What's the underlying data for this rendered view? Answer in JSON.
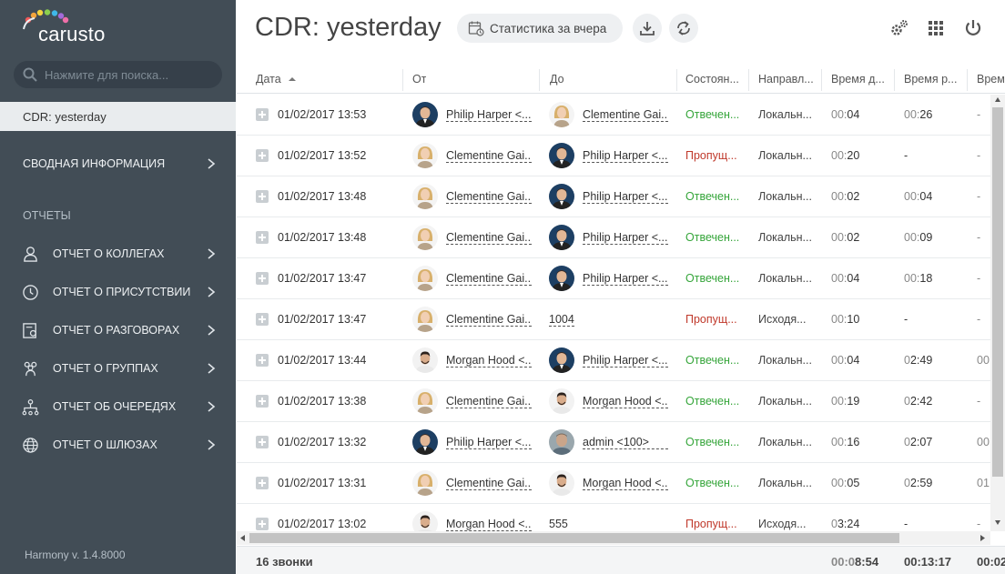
{
  "sidebar": {
    "logo_text": "carusto",
    "search_placeholder": "Нажмите для поиска...",
    "active_item": "CDR: yesterday",
    "summary_label": "СВОДНАЯ ИНФОРМАЦИЯ",
    "reports_title": "ОТЧЕТЫ",
    "items": [
      {
        "label": "ОТЧЕТ О КОЛЛЕГАХ",
        "icon": "user-icon"
      },
      {
        "label": "ОТЧЕТ О ПРИСУТСТВИИ",
        "icon": "clock-icon"
      },
      {
        "label": "ОТЧЕТ О РАЗГОВОРАХ",
        "icon": "conversation-report-icon"
      },
      {
        "label": "ОТЧЕТ О ГРУППАХ",
        "icon": "group-icon"
      },
      {
        "label": "ОТЧЕТ ОБ ОЧЕРЕДЯХ",
        "icon": "queue-icon"
      },
      {
        "label": "ОТЧЕТ О ШЛЮЗАХ",
        "icon": "globe-icon"
      }
    ],
    "version": "Harmony v. 1.4.8000"
  },
  "header": {
    "title": "CDR: yesterday",
    "stat_button": "Статистика за вчера"
  },
  "table": {
    "columns": [
      "Дата",
      "От",
      "До",
      "Состоян...",
      "Направл...",
      "Время д...",
      "Время р...",
      "Врем"
    ],
    "rows": [
      {
        "date": "01/02/2017 13:53",
        "from": "Philip Harper <...",
        "from_avatar": "philip",
        "to": "Clementine Gai...",
        "to_avatar": "clementine",
        "status": "Отвечен...",
        "status_type": "ok",
        "dir": "Локальн...",
        "t1a": "00:",
        "t1b": "04",
        "t2a": "00:",
        "t2b": "26",
        "t3": "-"
      },
      {
        "date": "01/02/2017 13:52",
        "from": "Clementine Gai...",
        "from_avatar": "clementine",
        "to": "Philip Harper <...",
        "to_avatar": "philip",
        "status": "Пропущ...",
        "status_type": "miss",
        "dir": "Локальн...",
        "t1a": "00:",
        "t1b": "20",
        "t2a": "",
        "t2b": "-",
        "t3": "-"
      },
      {
        "date": "01/02/2017 13:48",
        "from": "Clementine Gai...",
        "from_avatar": "clementine",
        "to": "Philip Harper <...",
        "to_avatar": "philip",
        "status": "Отвечен...",
        "status_type": "ok",
        "dir": "Локальн...",
        "t1a": "00:",
        "t1b": "02",
        "t2a": "00:",
        "t2b": "04",
        "t3": "-"
      },
      {
        "date": "01/02/2017 13:48",
        "from": "Clementine Gai...",
        "from_avatar": "clementine",
        "to": "Philip Harper <...",
        "to_avatar": "philip",
        "status": "Отвечен...",
        "status_type": "ok",
        "dir": "Локальн...",
        "t1a": "00:",
        "t1b": "02",
        "t2a": "00:",
        "t2b": "09",
        "t3": "-"
      },
      {
        "date": "01/02/2017 13:47",
        "from": "Clementine Gai...",
        "from_avatar": "clementine",
        "to": "Philip Harper <...",
        "to_avatar": "philip",
        "status": "Отвечен...",
        "status_type": "ok",
        "dir": "Локальн...",
        "t1a": "00:",
        "t1b": "04",
        "t2a": "00:",
        "t2b": "18",
        "t3": "-"
      },
      {
        "date": "01/02/2017 13:47",
        "from": "Clementine Gai...",
        "from_avatar": "clementine",
        "to": "1004",
        "to_avatar": "",
        "status": "Пропущ...",
        "status_type": "miss",
        "dir": "Исходя...",
        "t1a": "00:",
        "t1b": "10",
        "t2a": "",
        "t2b": "-",
        "t3": "-"
      },
      {
        "date": "01/02/2017 13:44",
        "from": "Morgan Hood <...",
        "from_avatar": "morgan",
        "to": "Philip Harper <...",
        "to_avatar": "philip",
        "status": "Отвечен...",
        "status_type": "ok",
        "dir": "Локальн...",
        "t1a": "00:",
        "t1b": "04",
        "t2a": "0",
        "t2b": "2:49",
        "t3": "00"
      },
      {
        "date": "01/02/2017 13:38",
        "from": "Clementine Gai...",
        "from_avatar": "clementine",
        "to": "Morgan Hood <...",
        "to_avatar": "morgan",
        "status": "Отвечен...",
        "status_type": "ok",
        "dir": "Локальн...",
        "t1a": "00:",
        "t1b": "19",
        "t2a": "0",
        "t2b": "2:42",
        "t3": "-"
      },
      {
        "date": "01/02/2017 13:32",
        "from": "Philip Harper <...",
        "from_avatar": "philip",
        "to": "admin <100>",
        "to_avatar": "admin",
        "status": "Отвечен...",
        "status_type": "ok",
        "dir": "Локальн...",
        "t1a": "00:",
        "t1b": "16",
        "t2a": "0",
        "t2b": "2:07",
        "t3": "00"
      },
      {
        "date": "01/02/2017 13:31",
        "from": "Clementine Gai...",
        "from_avatar": "clementine",
        "to": "Morgan Hood <...",
        "to_avatar": "morgan",
        "status": "Отвечен...",
        "status_type": "ok",
        "dir": "Локальн...",
        "t1a": "00:",
        "t1b": "05",
        "t2a": "0",
        "t2b": "2:59",
        "t3": "01"
      },
      {
        "date": "01/02/2017 13:02",
        "from": "Morgan Hood <...",
        "from_avatar": "morgan",
        "to": "555",
        "to_avatar": "",
        "status": "Пропущ...",
        "status_type": "miss",
        "dir": "Исходя...",
        "t1a": "0",
        "t1b": "3:24",
        "t2a": "",
        "t2b": "-",
        "t3": "-"
      }
    ]
  },
  "footer": {
    "count": "16 звонки",
    "total1a": "00:0",
    "total1b": "8:54",
    "total2": "00:13:17",
    "total3": "00:02"
  },
  "colors": {
    "sidebar_bg": "#424d56",
    "answered": "#35a53a",
    "missed": "#c0392b"
  }
}
